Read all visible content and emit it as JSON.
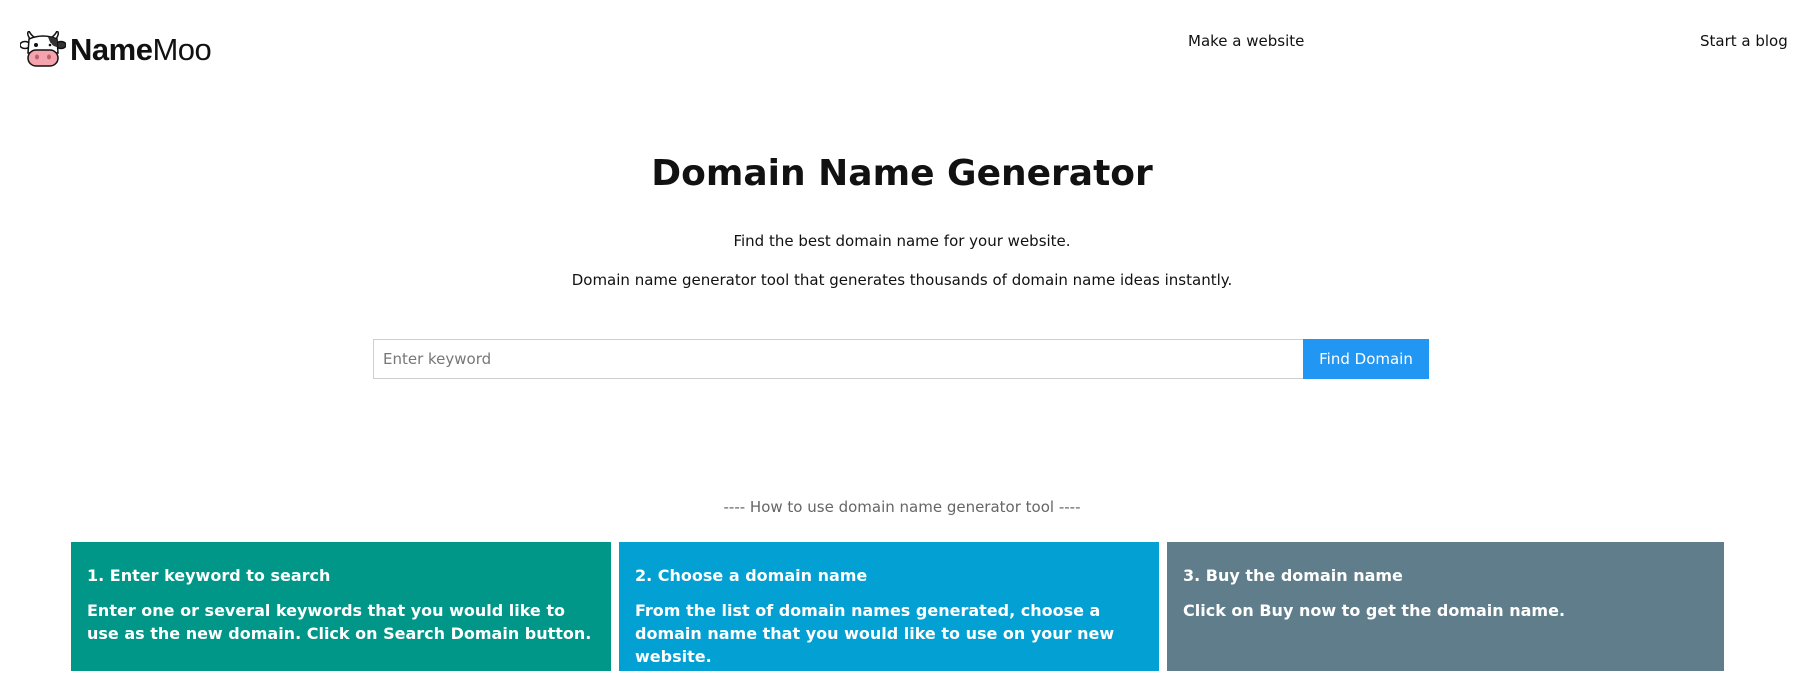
{
  "header": {
    "logo_text_bold": "Name",
    "logo_text_regular": "Moo",
    "nav": {
      "make_website": "Make a website",
      "start_blog": "Start a blog"
    }
  },
  "hero": {
    "title": "Domain Name Generator",
    "subtitle": "Find the best domain name for your website.",
    "description": "Domain name generator tool that generates thousands of domain name ideas instantly."
  },
  "search": {
    "placeholder": "Enter keyword",
    "value": "",
    "button_label": "Find Domain"
  },
  "howto": {
    "heading": "---- How to use domain name generator tool ----",
    "steps": [
      {
        "title": "1. Enter keyword to search",
        "text": "Enter one or several keywords that you would like to use as the new domain. Click on Search Domain button."
      },
      {
        "title": "2. Choose a domain name",
        "text": "From the list of domain names generated, choose a domain name that you would like to use on your new website."
      },
      {
        "title": "3. Buy the domain name",
        "text": "Click on Buy now to get the domain name."
      }
    ]
  },
  "colors": {
    "accent_button": "#2196f3",
    "step1_bg": "#009688",
    "step2_bg": "#03a0d4",
    "step3_bg": "#607d8b"
  },
  "icons": {
    "logo": "cow-face-icon"
  }
}
